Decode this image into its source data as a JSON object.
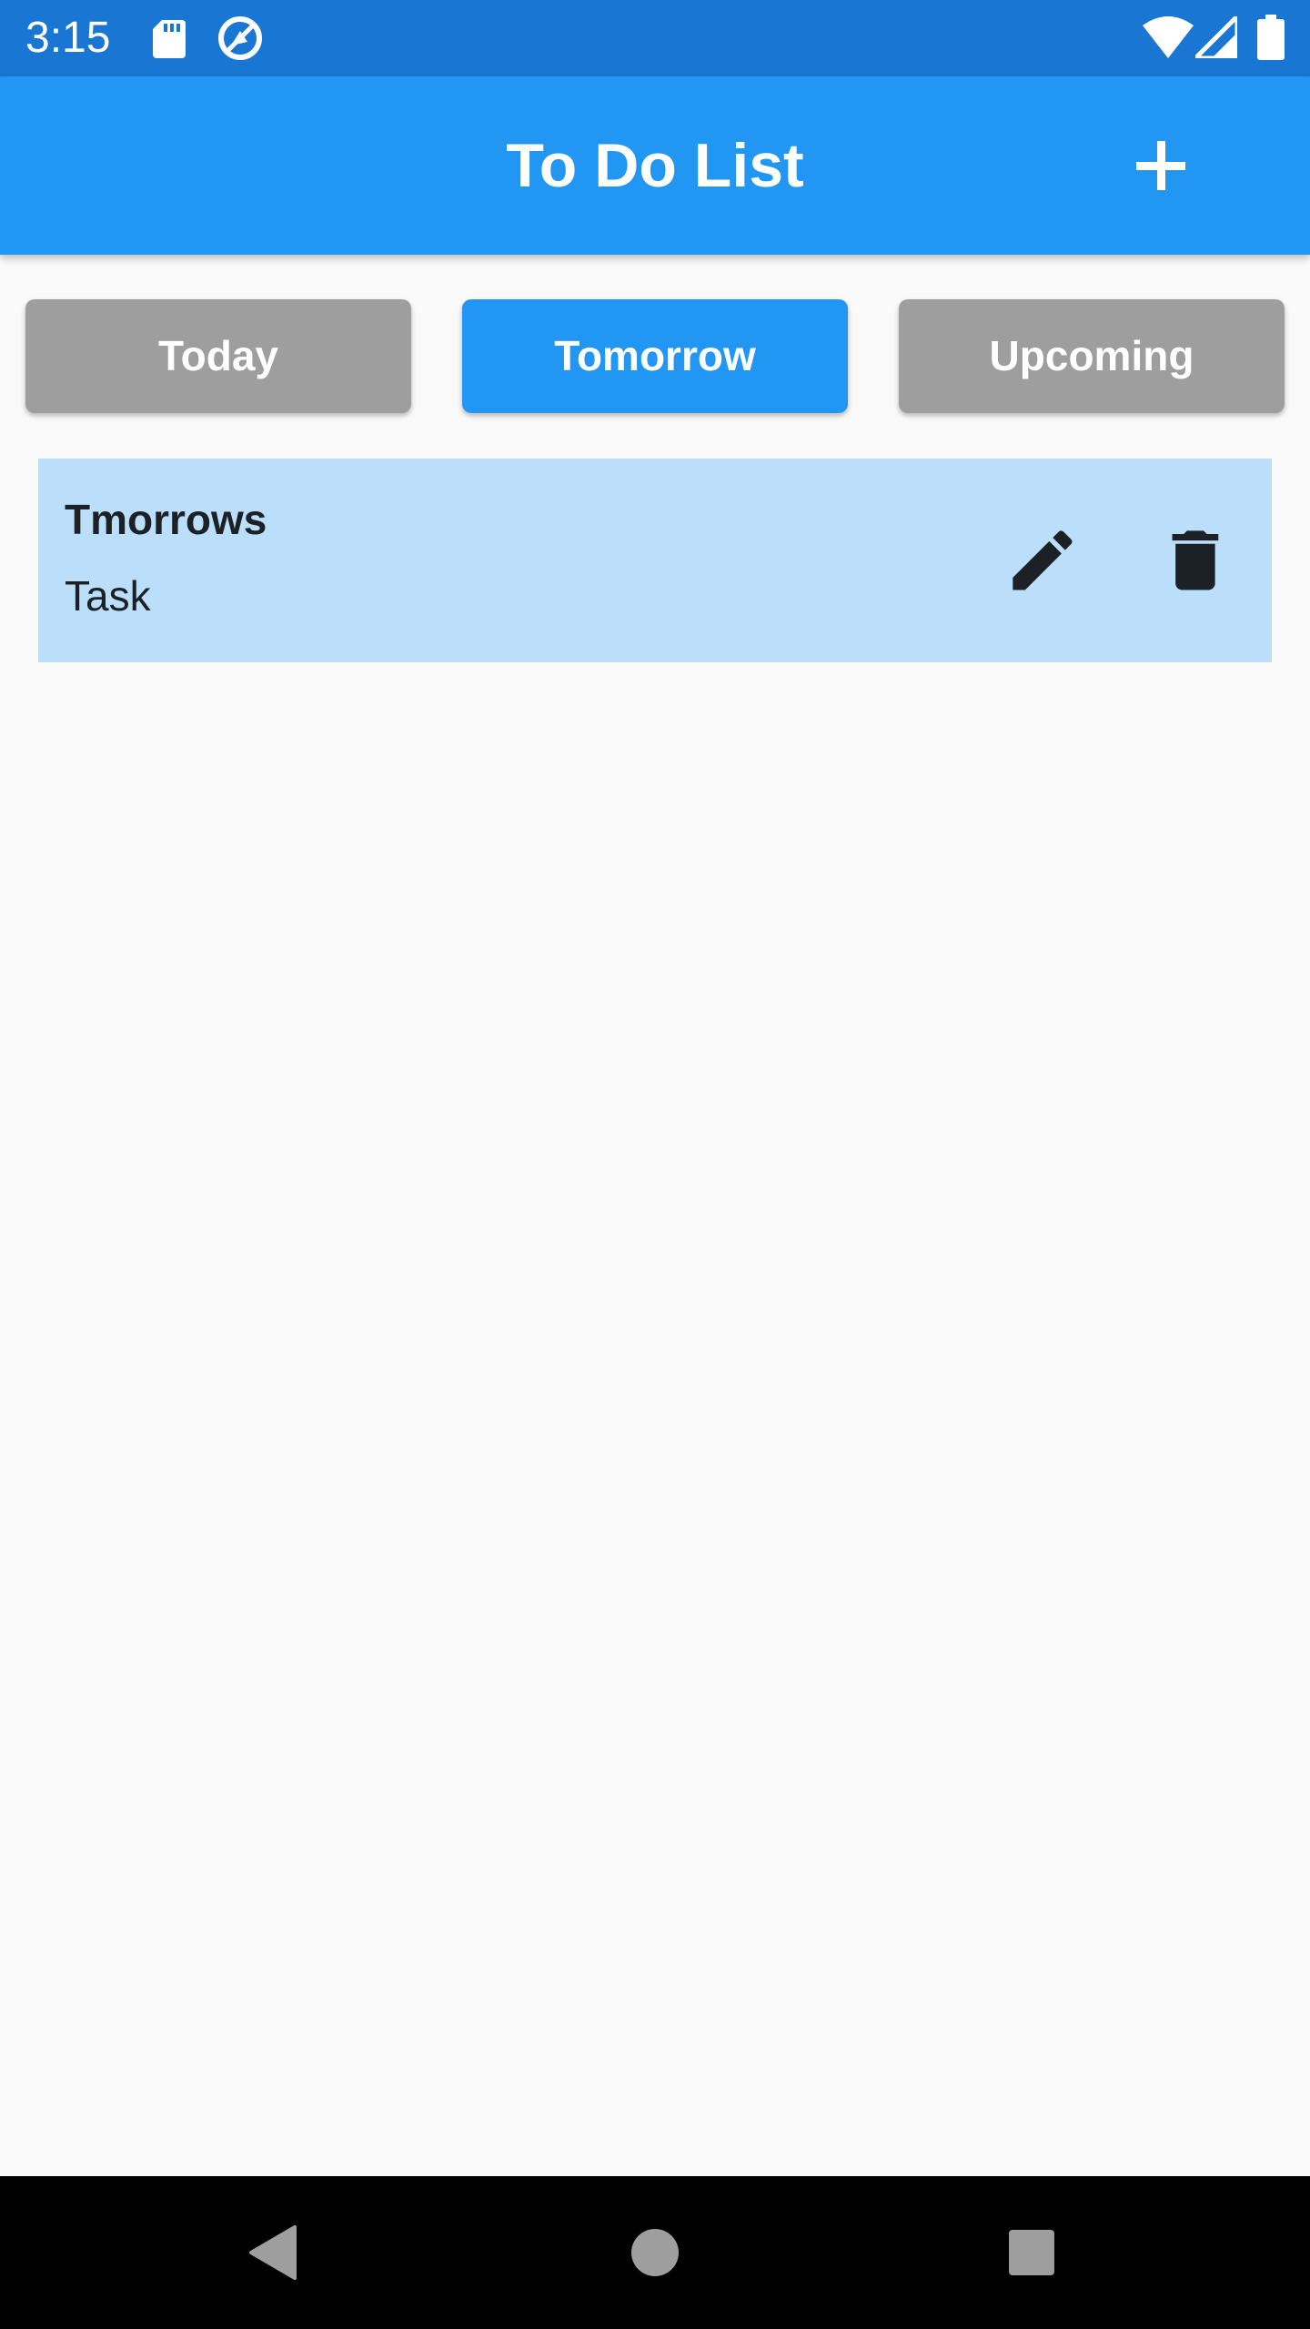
{
  "status_bar": {
    "time": "3:15",
    "icons": [
      "sd-card-icon",
      "vpn-icon",
      "wifi-icon",
      "signal-icon",
      "battery-icon"
    ]
  },
  "app_bar": {
    "title": "To Do List",
    "action_icon": "add-icon"
  },
  "tabs": [
    {
      "label": "Today",
      "selected": false
    },
    {
      "label": "Tomorrow",
      "selected": true
    },
    {
      "label": "Upcoming",
      "selected": false
    }
  ],
  "tasks": [
    {
      "title": "Tmorrows",
      "subtitle": "Task",
      "actions": [
        "edit-icon",
        "delete-icon"
      ]
    }
  ],
  "nav_bar": {
    "icons": [
      "back-icon",
      "home-icon",
      "recents-icon"
    ]
  },
  "colors": {
    "status_bar": "#1976d2",
    "primary": "#2196f3",
    "tab_inactive": "#9e9e9e",
    "card": "#bbdefb",
    "background": "#fafafa",
    "text_dark": "#1c2126",
    "nav_bar": "#000000"
  }
}
